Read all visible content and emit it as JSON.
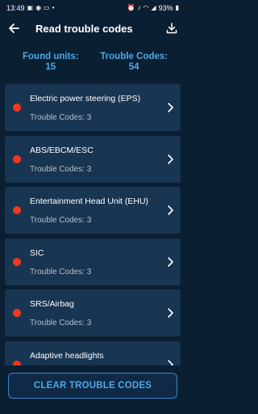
{
  "status_bar": {
    "time": "13:49",
    "battery": "93%",
    "left_icons": [
      "gallery-icon",
      "whatsapp-icon",
      "image-icon",
      "dot-icon"
    ],
    "right_icons": [
      "alarm-icon",
      "mute-icon",
      "wifi-icon",
      "signal-icon",
      "battery-icon"
    ]
  },
  "app_bar": {
    "title": "Read trouble codes"
  },
  "summary": {
    "found_units_label": "Found units:",
    "found_units_value": "15",
    "trouble_codes_label": "Trouble Codes:",
    "trouble_codes_value": "54"
  },
  "units": [
    {
      "name": "Electric power steering (EPS)",
      "codes": "Trouble Codes: 3"
    },
    {
      "name": "ABS/EBCM/ESC",
      "codes": "Trouble Codes: 3"
    },
    {
      "name": "Entertainment Head Unit (EHU)",
      "codes": "Trouble Codes: 3"
    },
    {
      "name": "SIC",
      "codes": "Trouble Codes: 3"
    },
    {
      "name": "SRS/Airbag",
      "codes": "Trouble Codes: 3"
    },
    {
      "name": "Adaptive headlights",
      "codes": ""
    }
  ],
  "colors": {
    "background": "#0b1f33",
    "card": "#183552",
    "accent": "#4fa8e6",
    "status_dot": "#f2381c"
  },
  "clear_button": {
    "label": "CLEAR TROUBLE CODES"
  }
}
